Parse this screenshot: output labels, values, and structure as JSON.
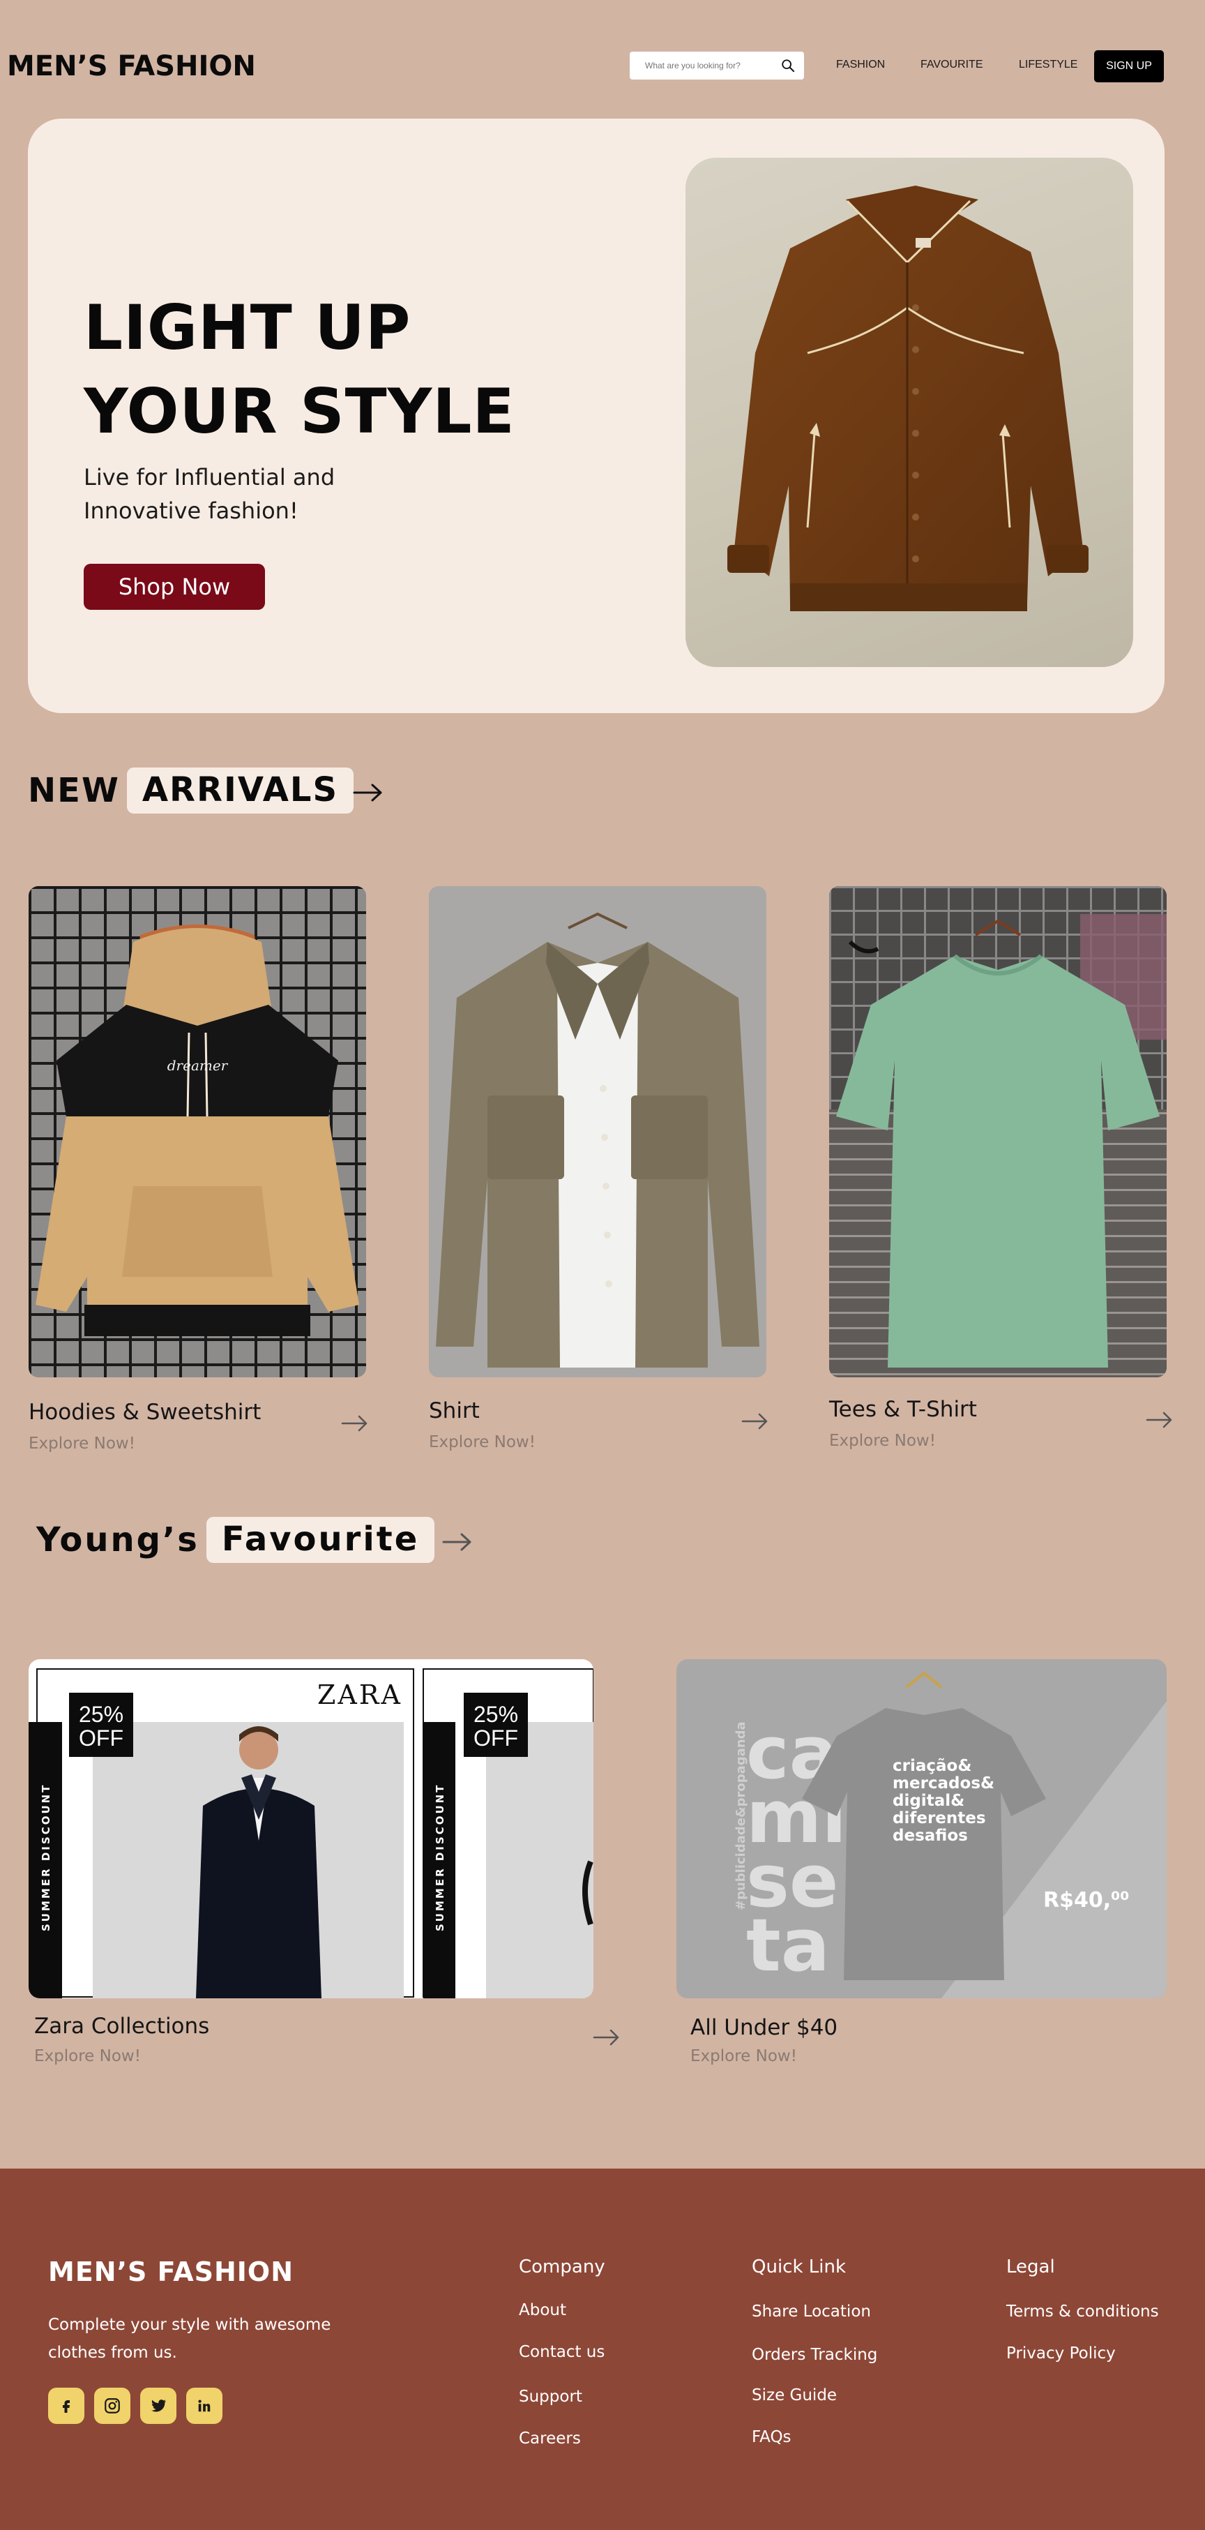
{
  "header": {
    "logo": "MEN’S FASHION",
    "search_placeholder": "What are you looking for?",
    "nav": [
      "FASHION",
      "FAVOURITE",
      "LIFESTYLE"
    ],
    "signup": "SIGN UP"
  },
  "hero": {
    "title_line1": "LIGHT UP",
    "title_line2": "YOUR STYLE",
    "subtitle": "Live for Influential and Innovative fashion!",
    "button": "Shop Now"
  },
  "new_arrivals": {
    "heading_plain": "NEW",
    "heading_pill": "ARRIVALS",
    "items": [
      {
        "title": "Hoodies & Sweetshirt",
        "cta": "Explore Now!",
        "hoodie_print": "dreamer"
      },
      {
        "title": "Shirt",
        "cta": "Explore Now!"
      },
      {
        "title": "Tees & T-Shirt",
        "cta": "Explore Now!"
      }
    ]
  },
  "favourite": {
    "heading_plain": "Young’s",
    "heading_pill": "Favourite",
    "items": [
      {
        "title": "Zara Collections",
        "cta": "Explore Now!"
      },
      {
        "title": "All Under $40",
        "cta": "Explore Now!"
      }
    ],
    "zara_banner": {
      "brand": "ZARA",
      "discount_line1": "25%",
      "discount_line2": "OFF",
      "side_text": "SUMMER DISCOUNT"
    },
    "tee_banner": {
      "big_word": [
        "ca",
        "mi",
        "se",
        "ta"
      ],
      "vertical_tag": "#publicidade&propaganda",
      "shirt_text": [
        "criação&",
        "mercados&",
        "digital&",
        "diferentes",
        "desafios"
      ],
      "price": "R$40,⁰⁰"
    }
  },
  "footer": {
    "logo": "MEN’S FASHION",
    "tagline": "Complete your style with awesome clothes from us.",
    "social_icons": [
      "facebook-icon",
      "instagram-icon",
      "twitter-icon",
      "linkedin-icon"
    ],
    "columns": [
      {
        "title": "Company",
        "links": [
          "About",
          "Contact us",
          "Support",
          "Careers"
        ]
      },
      {
        "title": "Quick Link",
        "links": [
          "Share Location",
          "Orders Tracking",
          "Size Guide",
          "FAQs"
        ]
      },
      {
        "title": "Legal",
        "links": [
          "Terms & conditions",
          "Privacy Policy"
        ]
      }
    ]
  },
  "colors": {
    "page_bg": "#d2b4a3",
    "hero_bg": "#f7ece3",
    "cta_red": "#7a0a18",
    "footer_bg": "#8d4737",
    "social_bg": "#f0d36b"
  }
}
